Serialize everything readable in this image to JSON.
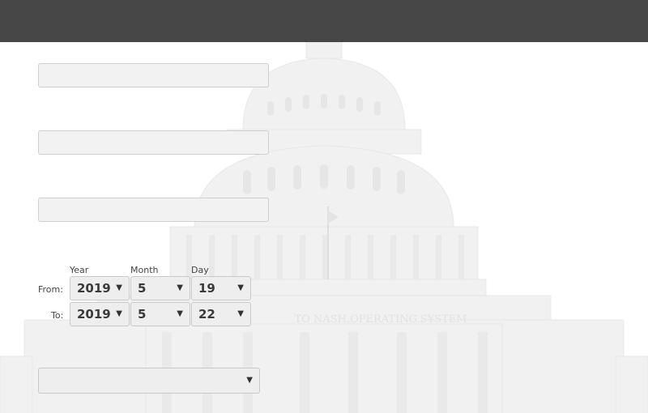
{
  "topbar": {
    "color": "#474747"
  },
  "date_range": {
    "headers": {
      "year": "Year",
      "month": "Month",
      "day": "Day"
    },
    "from": {
      "label": "From:",
      "year": "2019",
      "month": "5",
      "day": "19"
    },
    "to": {
      "label": "To:",
      "year": "2019",
      "month": "5",
      "day": "22"
    }
  },
  "background_watermark": {
    "inscription": "TO NASH.OPERATING.SYSTEM"
  },
  "dropdown": {
    "selected": ""
  },
  "icons": {
    "dropdown_arrow": "triangle-down"
  }
}
